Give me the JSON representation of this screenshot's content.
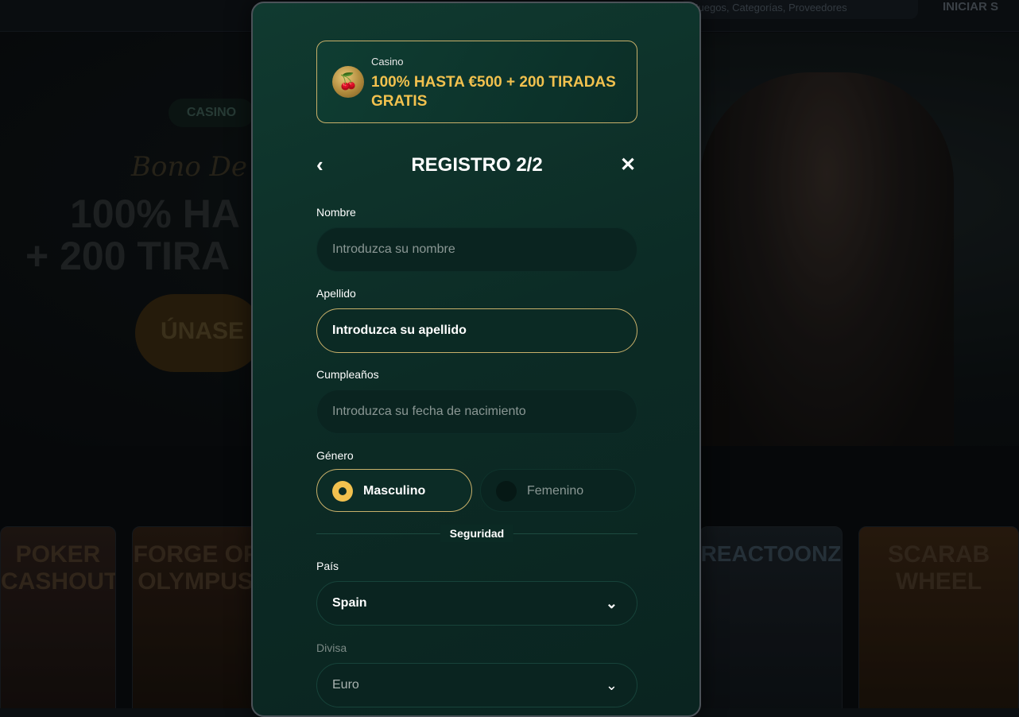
{
  "background": {
    "search_placeholder": "Juegos, Categorías, Proveedores",
    "login_label": "INICIAR S",
    "chip_label": "CASINO",
    "script_text": "Bono De ...",
    "hero_line1": "100% HA",
    "hero_line2": "+ 200 TIRA",
    "join_label": "ÚNASE",
    "games": [
      "POKER CASHOUT",
      "FORGE OF OLYMPUS",
      "REACTOONZ",
      "SCARAB WHEEL"
    ]
  },
  "promo": {
    "category": "Casino",
    "title": "100% HASTA €500 + 200 TIRADAS GRATIS",
    "icon": "cherry-coin-icon"
  },
  "header": {
    "title": "REGISTRO 2/2",
    "back_glyph": "‹",
    "close_glyph": "✕"
  },
  "form": {
    "name": {
      "label": "Nombre",
      "placeholder": "Introduzca su nombre"
    },
    "surname": {
      "label": "Apellido",
      "placeholder": "Introduzca su apellido"
    },
    "birthday": {
      "label": "Cumpleaños",
      "placeholder": "Introduzca su fecha de nacimiento"
    },
    "gender": {
      "label": "Género",
      "options": [
        "Masculino",
        "Femenino"
      ],
      "selected": "Masculino"
    },
    "security_heading": "Seguridad",
    "country": {
      "label": "País",
      "value": "Spain"
    },
    "currency": {
      "label": "Divisa",
      "value": "Euro"
    }
  },
  "colors": {
    "accent_gold": "#f2c14e",
    "modal_bg": "#0c2b25",
    "border_gold": "#c8b06a"
  }
}
